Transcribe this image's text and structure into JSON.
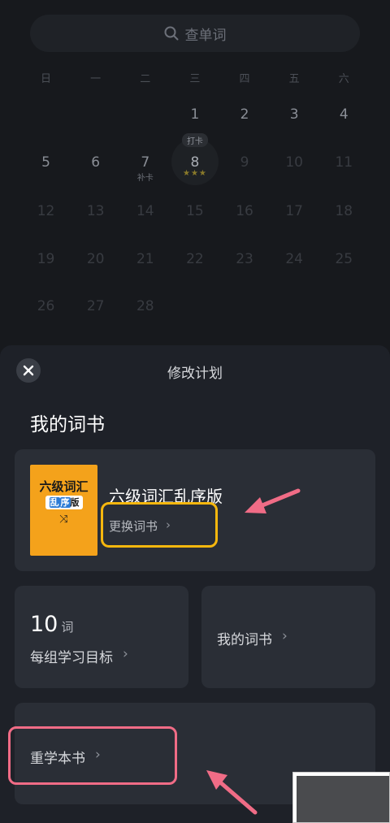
{
  "search": {
    "placeholder": "查单词"
  },
  "calendar": {
    "weekdays": [
      "日",
      "一",
      "二",
      "三",
      "四",
      "五",
      "六"
    ],
    "week1": [
      "",
      "",
      "",
      "1",
      "2",
      "3",
      "4"
    ],
    "week2": [
      "5",
      "6",
      "7",
      "8",
      "9",
      "10",
      "11"
    ],
    "week3": [
      "12",
      "13",
      "14",
      "15",
      "16",
      "17",
      "18"
    ],
    "week4": [
      "19",
      "20",
      "21",
      "22",
      "23",
      "24",
      "25"
    ],
    "week5": [
      "26",
      "27",
      "28"
    ],
    "makeup_label": "补卡",
    "clockin_tag": "打卡",
    "today_stars": "★★★"
  },
  "sheet": {
    "title": "修改计划",
    "section_title": "我的词书",
    "book": {
      "name": "六级词汇乱序版",
      "cover_line1": "六级词汇",
      "cover_line2a": "乱",
      "cover_line2b": "序",
      "cover_line2c": "版",
      "change_label": "更换词书"
    },
    "goal": {
      "number": "10",
      "unit": "词",
      "label": "每组学习目标"
    },
    "my_books_label": "我的词书",
    "relearn_label": "重学本书",
    "chevron": "›"
  },
  "colors": {
    "accent_yellow": "#f6b70e",
    "accent_pink": "#f06c86",
    "sheet_bg": "#1e2128",
    "card_bg": "#2a2e36",
    "cover_orange": "#f4a21b"
  }
}
